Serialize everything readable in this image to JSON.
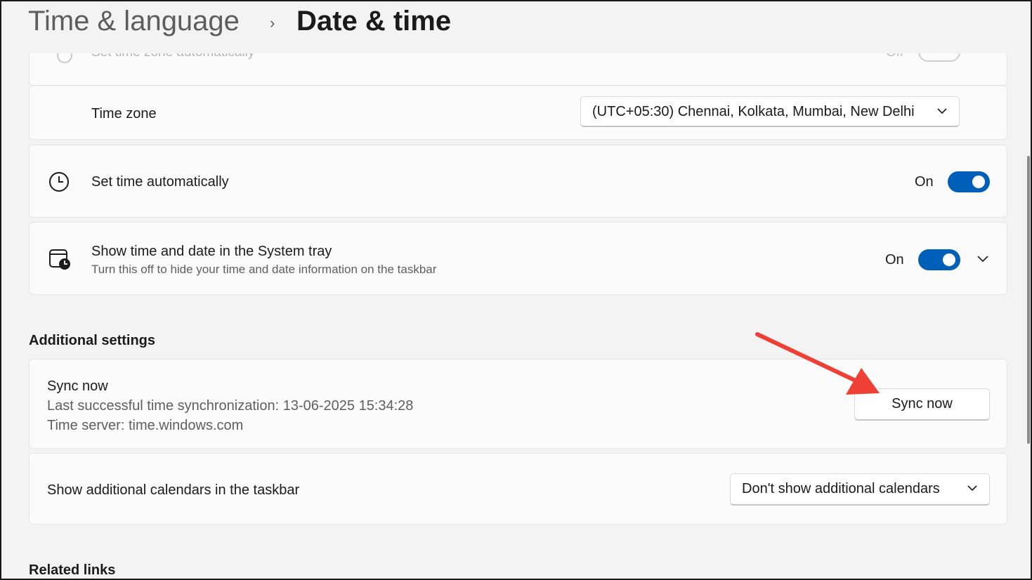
{
  "header": {
    "parent": "Time & language",
    "separator": "›",
    "current": "Date & time"
  },
  "ghost_row": {
    "label": "Set time zone automatically",
    "state": "Off"
  },
  "time_zone": {
    "label": "Time zone",
    "value": "(UTC+05:30) Chennai, Kolkata, Mumbai, New Delhi"
  },
  "set_time_auto": {
    "label": "Set time automatically",
    "state": "On"
  },
  "system_tray": {
    "label": "Show time and date in the System tray",
    "description": "Turn this off to hide your time and date information on the taskbar",
    "state": "On"
  },
  "additional": {
    "title": "Additional settings",
    "sync": {
      "title": "Sync now",
      "last_sync": "Last successful time synchronization: 13-06-2025 15:34:28",
      "server": "Time server: time.windows.com",
      "button": "Sync now"
    },
    "calendars": {
      "label": "Show additional calendars in the taskbar",
      "value": "Don't show additional calendars"
    }
  },
  "related": {
    "title": "Related links"
  },
  "colors": {
    "accent": "#005fb8",
    "annotation_arrow": "#ef4036"
  }
}
